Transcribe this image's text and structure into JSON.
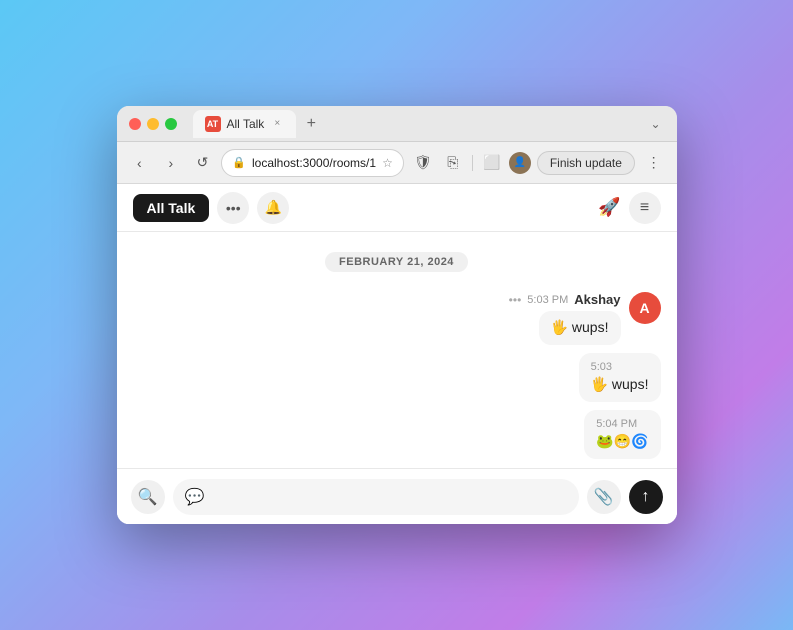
{
  "browser": {
    "tab": {
      "favicon_label": "AT",
      "title": "All Talk",
      "close_label": "×",
      "new_tab_label": "+"
    },
    "toolbar": {
      "back_label": "‹",
      "forward_label": "›",
      "reload_label": "↺",
      "url": "localhost:3000/rooms/1",
      "finish_update_label": "Finish update",
      "more_label": "⋮",
      "dropdown_label": "⌄"
    }
  },
  "chat": {
    "header": {
      "title": "All Talk",
      "more_label": "•••",
      "bell_label": "🔔",
      "menu_label": "≡"
    },
    "date_divider": "FEBRUARY 21, 2024",
    "messages": [
      {
        "id": "msg1",
        "time": "5:03 PM",
        "author": "Akshay",
        "avatar_label": "A",
        "content": "🖐 wups!",
        "has_more": true
      },
      {
        "id": "msg2",
        "time": "5:03",
        "content": "🖐 wups!",
        "standalone": true
      },
      {
        "id": "msg3",
        "time": "5:04 PM",
        "content": "🐸😁🌀",
        "standalone": true
      }
    ],
    "input": {
      "placeholder": "",
      "search_label": "🔍",
      "compose_label": "💬",
      "attachment_label": "📎",
      "send_label": "↑"
    }
  }
}
